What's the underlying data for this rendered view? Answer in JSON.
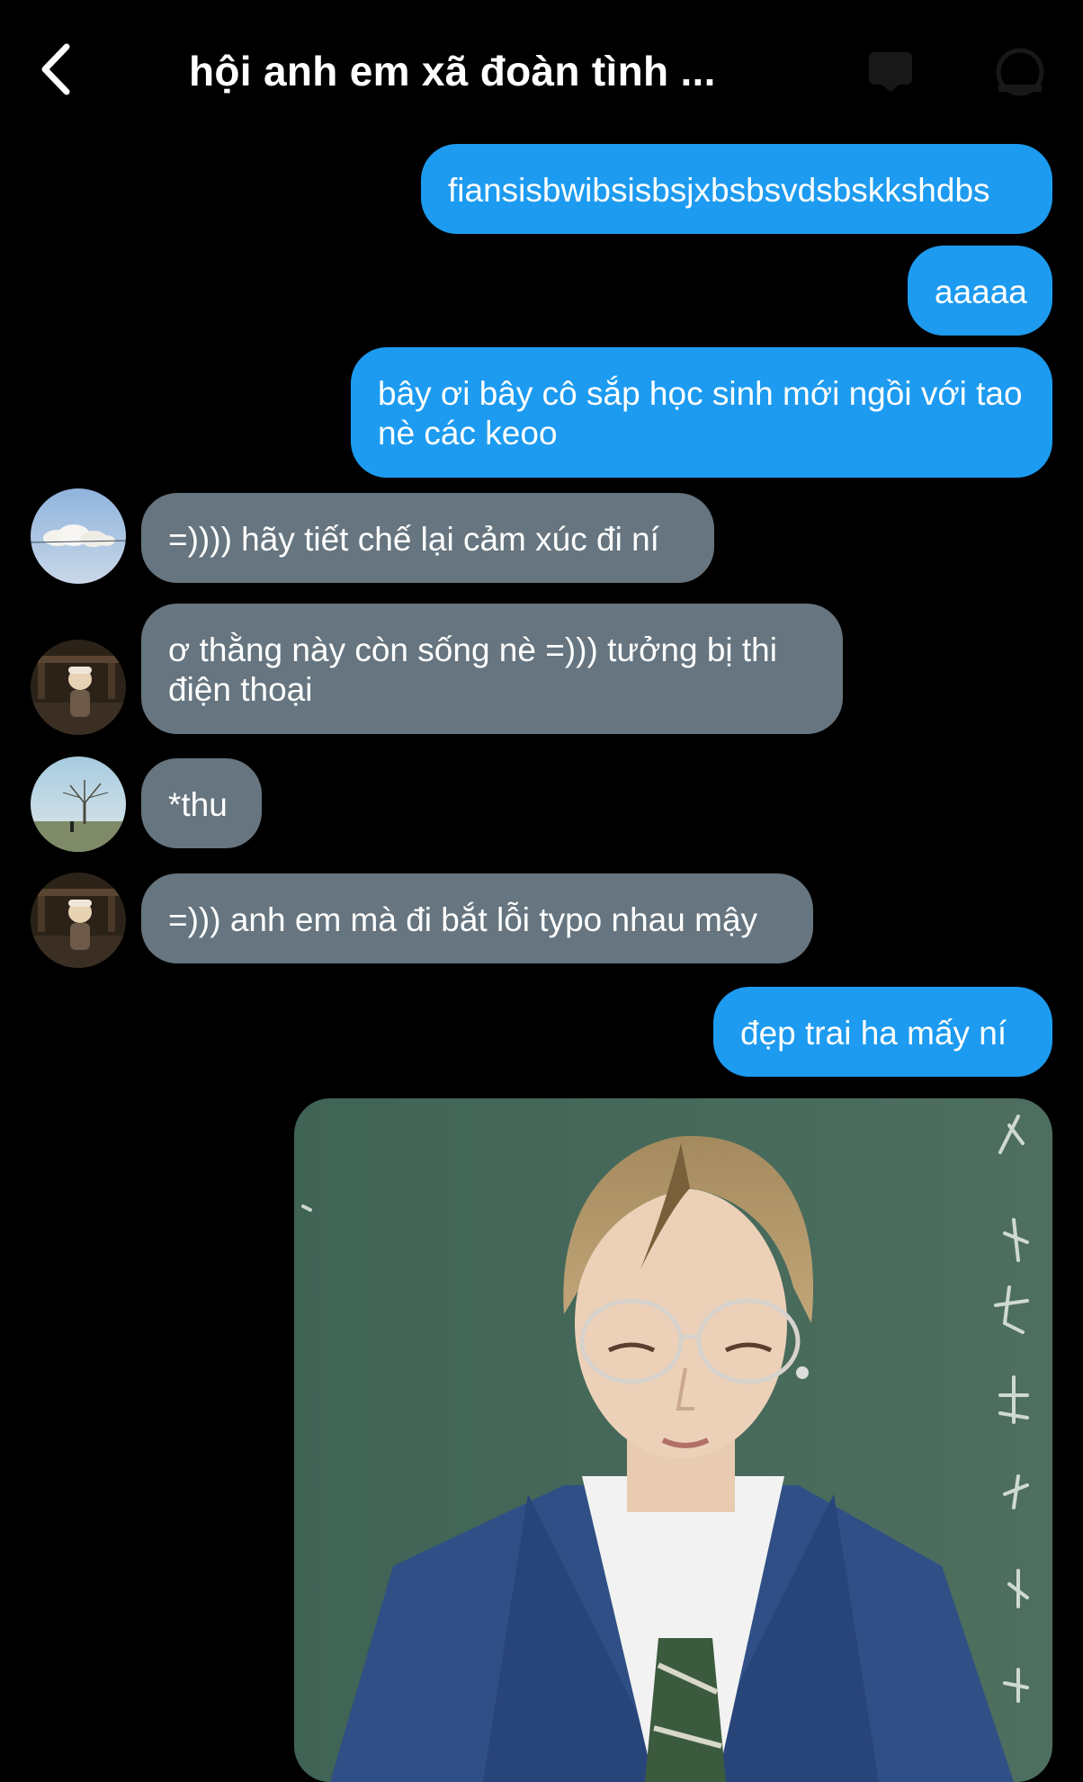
{
  "header": {
    "title": "hội anh em xã đoàn tình ...",
    "back_icon": "chevron-left-icon",
    "video_call_icon": "video-call-icon",
    "info_icon": "info-icon"
  },
  "messages": [
    {
      "direction": "outgoing",
      "text": "fiansisbwibsisbsjxbsbsvdsbskkshdbs"
    },
    {
      "direction": "outgoing",
      "text": "aaaaa"
    },
    {
      "direction": "outgoing",
      "text": "bây ơi bây cô sắp học sinh mới ngồi với tao nè các keoo"
    },
    {
      "direction": "incoming",
      "text": "=)))) hãy tiết chế lại cảm xúc đi ní"
    },
    {
      "direction": "incoming",
      "text": "ơ thằng này còn sống nè =))) tưởng bị thi điện thoại"
    },
    {
      "direction": "incoming",
      "text": "*thu"
    },
    {
      "direction": "incoming",
      "text": "=))) anh em mà đi bắt lỗi typo nhau mậy"
    },
    {
      "direction": "outgoing",
      "text": "đẹp trai ha mấy ní"
    }
  ],
  "colors": {
    "outgoing_bubble": "#1d9bf0",
    "incoming_bubble": "#66757f",
    "background": "#000000"
  }
}
